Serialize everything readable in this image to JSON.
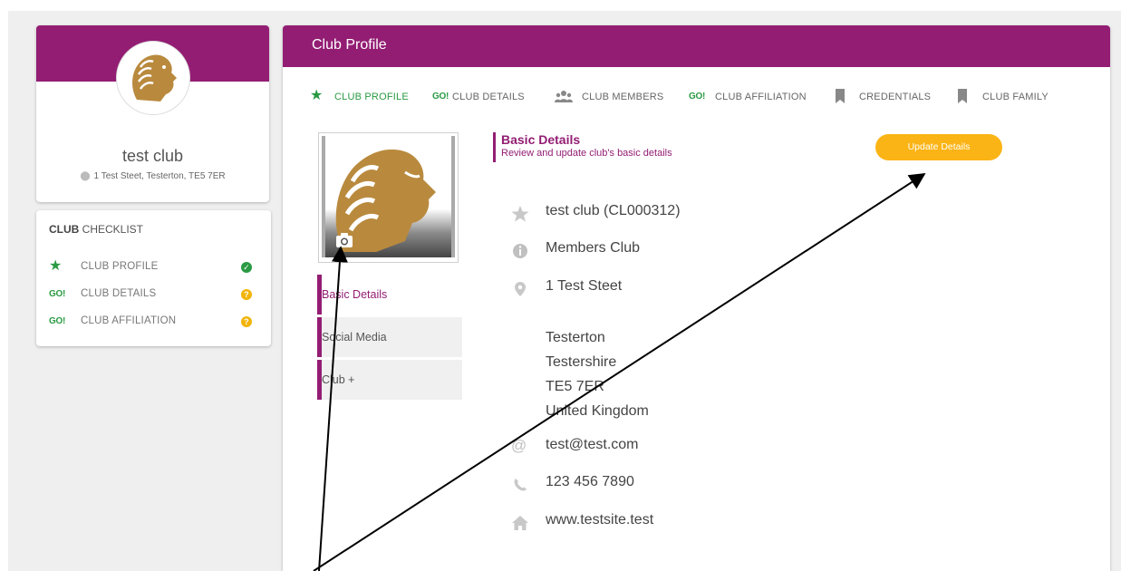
{
  "profile": {
    "name": "test club",
    "address": "1 Test Steet, Testerton, TE5 7ER"
  },
  "checklist": {
    "title_bold": "CLUB",
    "title_rest": " CHECKLIST",
    "items": [
      {
        "icon": "star-icon",
        "label": "CLUB PROFILE",
        "status": "complete"
      },
      {
        "icon": "go-icon",
        "label": "CLUB DETAILS",
        "status": "incomplete"
      },
      {
        "icon": "go-icon",
        "label": "CLUB AFFILIATION",
        "status": "incomplete"
      }
    ],
    "go_text": "GO!",
    "status_ok_glyph": "✓",
    "status_warn_glyph": "?"
  },
  "main": {
    "title": "Club Profile",
    "tabs": [
      {
        "label": "CLUB PROFILE",
        "icon": "star-icon",
        "active": true
      },
      {
        "label": "CLUB DETAILS",
        "icon": "go-icon",
        "active": false
      },
      {
        "label": "CLUB MEMBERS",
        "icon": "members-icon",
        "active": false
      },
      {
        "label": "CLUB AFFILIATION",
        "icon": "go-icon",
        "active": false
      },
      {
        "label": "CREDENTIALS",
        "icon": "bookmark-icon",
        "active": false
      },
      {
        "label": "CLUB FAMILY",
        "icon": "bookmark-icon",
        "active": false
      }
    ],
    "side_nav": [
      {
        "label": "Basic Details",
        "active": true
      },
      {
        "label": "Social Media",
        "active": false
      },
      {
        "label": "Club +",
        "active": false
      }
    ],
    "section": {
      "title": "Basic Details",
      "subtitle": "Review and update club's basic details"
    },
    "update_button": "Update Details",
    "details": {
      "name_line": "test club (CL000312)",
      "type": "Members Club",
      "address_line1": "1 Test Steet",
      "address_lines": [
        "Testerton",
        "Testershire",
        "TE5 7ER",
        "United Kingdom"
      ],
      "email": "test@test.com",
      "phone": "123 456 7890",
      "website": "www.testsite.test"
    }
  },
  "colors": {
    "brand": "#931d73",
    "accent_green": "#2a9a43",
    "button_yellow": "#fbb415",
    "lion_gold": "#b98a3e"
  }
}
